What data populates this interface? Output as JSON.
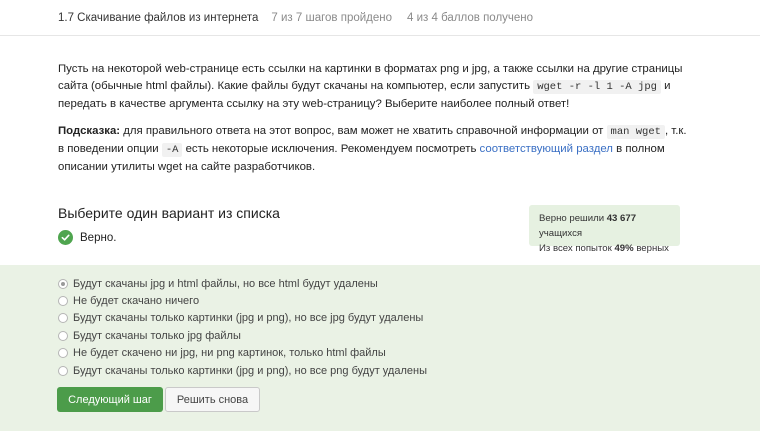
{
  "header": {
    "lesson": "1.7 Скачивание файлов из интернета",
    "steps": "7 из 7 шагов пройдено",
    "score": "4 из 4 баллов  получено"
  },
  "question": {
    "p1_a": "Пусть на некоторой web-странице есть ссылки на картинки в форматах png и jpg, а также ссылки на другие страницы сайта (обычные html файлы). Какие файлы будут скачаны на компьютер, если запустить ",
    "p1_code": "wget -r -l 1 -A jpg",
    "p1_b": " и передать в качестве аргумента ссылку на эту web-страницу? Выберите наиболее полный ответ!",
    "hint_label": "Подсказка:",
    "hint_a": " для правильного ответа на этот вопрос, вам может не хватить справочной информации от ",
    "hint_code1": "man wget",
    "hint_b": ", т.к. в поведении опции ",
    "hint_code2": "-A",
    "hint_c": " есть некоторые исключения. Рекомендуем посмотреть ",
    "hint_link": "соответствующий раздел",
    "hint_d": " в полном описании утилиты wget на сайте разработчиков."
  },
  "choose_title": "Выберите один вариант из списка",
  "result": "Верно.",
  "stats": {
    "line1_pre": "Верно решили ",
    "line1_num": "43 677",
    "line1_post": " учащихся",
    "line2_pre": "Из всех попыток ",
    "line2_num": "49%",
    "line2_post": " верных"
  },
  "options": [
    {
      "label": "Будут скачаны jpg и html файлы, но все html будут удалены",
      "selected": true
    },
    {
      "label": "Не будет скачано ничего",
      "selected": false
    },
    {
      "label": "Будут скачаны только картинки (jpg и png), но все jpg будут удалены",
      "selected": false
    },
    {
      "label": "Будут скачаны только jpg файлы",
      "selected": false
    },
    {
      "label": "Не будет скачено ни jpg, ни png картинок, только html файлы",
      "selected": false
    },
    {
      "label": "Будут скачаны только картинки (jpg и png), но все png будут удалены",
      "selected": false
    }
  ],
  "buttons": {
    "next": "Следующий шаг",
    "retry": "Решить снова"
  },
  "colors": {
    "accent_green": "#4c9c4a",
    "answers_bg": "#eaf2e5",
    "link": "#3a6fc4"
  },
  "icons": {
    "result": "check-circle-icon"
  }
}
